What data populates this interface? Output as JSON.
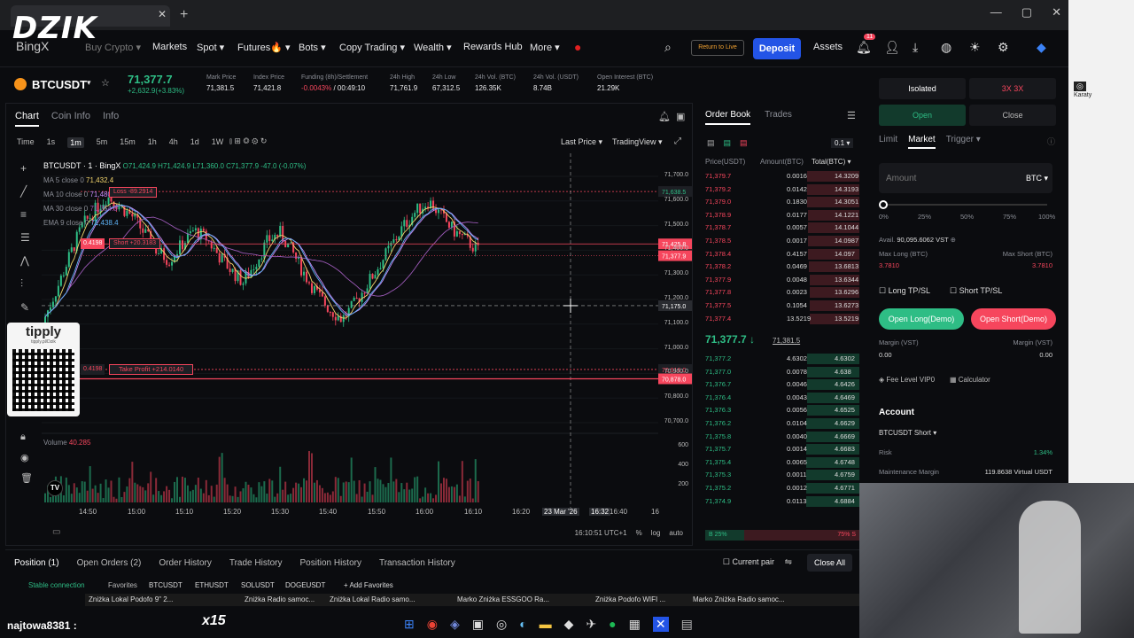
{
  "browser": {
    "new_tab": "+",
    "close_tab": "✕",
    "win": [
      "—",
      "▢",
      "✕"
    ]
  },
  "overlay": {
    "logo": "DZIK",
    "sub": "BingX"
  },
  "nav": {
    "items": [
      "Buy Crypto ▾",
      "Markets",
      "Spot ▾",
      "Futures🔥 ▾",
      "Bots ▾",
      "Copy Trading ▾",
      "Wealth ▾",
      "Rewards Hub",
      "More ▾"
    ],
    "return_live": "Return to Live",
    "deposit": "Deposit",
    "assets": "Assets",
    "notif_count": "11"
  },
  "ticker": {
    "symbol": "BTCUSDT",
    "last_price": "71,377.7",
    "change": "+2,632.9(+3.83%)",
    "stats": [
      {
        "label": "Mark Price",
        "value": "71,381.5"
      },
      {
        "label": "Index Price",
        "value": "71,421.8"
      },
      {
        "label": "Funding (8h)/Settlement",
        "value": "-0.0043%",
        "value2": "00:49:10"
      },
      {
        "label": "24h High",
        "value": "71,761.9"
      },
      {
        "label": "24h Low",
        "value": "67,312.5"
      },
      {
        "label": "24h Vol. (BTC)",
        "value": "126.35K"
      },
      {
        "label": "24h Vol. (USDT)",
        "value": "8.74B"
      },
      {
        "label": "Open Interest (BTC)",
        "value": "21.29K"
      }
    ]
  },
  "chart": {
    "tabs": [
      "Chart",
      "Coin Info",
      "Info"
    ],
    "timeframes": [
      "Time",
      "1s",
      "1m",
      "5m",
      "15m",
      "1h",
      "4h",
      "1d",
      "1W"
    ],
    "last_price_menu": "Last Price ▾",
    "tradingview_menu": "TradingView ▾",
    "legend": {
      "title": "BTCUSDT · 1 · BingX",
      "ohlc": "O71,424.9 H71,424.9 L71,360.0 C71,377.9 -47.0 (-0.07%)",
      "ma5": "MA 5 close 0",
      "ma5_val": "71,432.4",
      "ma10": "MA 10 close 0",
      "ma10_val": "71,480.8",
      "ma30": "MA 30 close 0",
      "ma30_val": "71,354.0",
      "ema9": "EMA 9 close 0",
      "ema9_val": "71,438.4",
      "volume": "Volume",
      "volume_val": "40.285"
    },
    "position_labels": {
      "stop_loss": "Loss -89.2914",
      "short": "Short +20.3183",
      "short_qty": "0.4198",
      "take_profit": "Take Profit +214.0140",
      "tp_qty": "0.4198"
    },
    "price_axis": [
      "71,700.0",
      "71,600.0",
      "71,500.0",
      "71,400.0",
      "71,300.0",
      "71,200.0",
      "71,100.0",
      "71,000.0",
      "70,900.0",
      "70,800.0",
      "70,700.0"
    ],
    "price_tags": {
      "top": "71,638.5",
      "short": "71,425.8",
      "last": "71,377.9",
      "cross": "71,175.0",
      "tp": "70,916.0",
      "red": "70,878.0"
    },
    "vol_axis": [
      "600",
      "400",
      "200"
    ],
    "time_axis": [
      "14:50",
      "15:00",
      "15:10",
      "15:20",
      "15:30",
      "15:40",
      "15:50",
      "16:00",
      "16:10",
      "16:20",
      "23 Mar '26",
      "16:32",
      "16:40",
      "16"
    ],
    "footer": {
      "clock": "16:10:51 UTC+1",
      "pct": "%",
      "log": "log",
      "auto": "auto"
    }
  },
  "tippy": {
    "brand": "tipply",
    "url": "tipply.pl/Dzik"
  },
  "orderbook": {
    "tabs": [
      "Order Book",
      "Trades"
    ],
    "step": "0.1 ▾",
    "headers": [
      "Price(USDT)",
      "Amount(BTC)",
      "Total(BTC) ▾"
    ],
    "asks": [
      [
        "71,379.7",
        "0.0016",
        "14.3209"
      ],
      [
        "71,379.2",
        "0.0142",
        "14.3193"
      ],
      [
        "71,379.0",
        "0.1830",
        "14.3051"
      ],
      [
        "71,378.9",
        "0.0177",
        "14.1221"
      ],
      [
        "71,378.7",
        "0.0057",
        "14.1044"
      ],
      [
        "71,378.5",
        "0.0017",
        "14.0987"
      ],
      [
        "71,378.4",
        "0.4157",
        "14.097"
      ],
      [
        "71,378.2",
        "0.0469",
        "13.6813"
      ],
      [
        "71,377.9",
        "0.0048",
        "13.6344"
      ],
      [
        "71,377.8",
        "0.0023",
        "13.6296"
      ],
      [
        "71,377.5",
        "0.1054",
        "13.6273"
      ],
      [
        "71,377.4",
        "13.5219",
        "13.5219"
      ]
    ],
    "mid": "71,377.7 ↓",
    "mid_mark": "71,381.5",
    "bids": [
      [
        "71,377.2",
        "4.6302",
        "4.6302"
      ],
      [
        "71,377.0",
        "0.0078",
        "4.638"
      ],
      [
        "71,376.7",
        "0.0046",
        "4.6426"
      ],
      [
        "71,376.4",
        "0.0043",
        "4.6469"
      ],
      [
        "71,376.3",
        "0.0056",
        "4.6525"
      ],
      [
        "71,376.2",
        "0.0104",
        "4.6629"
      ],
      [
        "71,375.8",
        "0.0040",
        "4.6669"
      ],
      [
        "71,375.7",
        "0.0014",
        "4.6683"
      ],
      [
        "71,375.4",
        "0.0065",
        "4.6748"
      ],
      [
        "71,375.3",
        "0.0011",
        "4.6759"
      ],
      [
        "71,375.2",
        "0.0012",
        "4.6771"
      ],
      [
        "71,374.9",
        "0.0113",
        "4.6884"
      ]
    ],
    "ratio": {
      "buy": "B  25%",
      "sell": "75%  S"
    }
  },
  "trade": {
    "margin_mode": "Isolated",
    "leverage": "3X  3X",
    "open": "Open",
    "close": "Close",
    "types": [
      "Limit",
      "Market",
      "Trigger ▾"
    ],
    "amount_placeholder": "Amount",
    "amount_unit": "BTC ▾",
    "slider_marks": [
      "0%",
      "25%",
      "50%",
      "75%",
      "100%"
    ],
    "avail_label": "Avail.",
    "avail_value": "90,095.6062 VST",
    "max_long_label": "Max Long (BTC)",
    "max_long_value": "3.7810",
    "max_short_label": "Max Short (BTC)",
    "max_short_value": "3.7810",
    "long_tpsl": "Long TP/SL",
    "short_tpsl": "Short TP/SL",
    "open_long": "Open Long(Demo)",
    "open_short": "Open Short(Demo)",
    "margin_long_label": "Margin (VST)",
    "margin_long_value": "0.00",
    "margin_short_label": "Margin (VST)",
    "margin_short_value": "0.00",
    "fee_level": "Fee Level VIP0",
    "calculator": "Calculator",
    "account": "Account",
    "account_pos": "BTCUSDT Short ▾",
    "risk_label": "Risk",
    "risk_value": "1.34%",
    "mm_label": "Maintenance Margin",
    "mm_value": "119.8638 Virtual USDT"
  },
  "positions": {
    "tabs": [
      "Position (1)",
      "Open Orders (2)",
      "Order History",
      "Trade History",
      "Position History",
      "Transaction History"
    ],
    "current_pair": "Current pair",
    "close_all": "Close All"
  },
  "favorites": {
    "connection": "Stable connection",
    "favorites_label": "Favorites",
    "pairs": [
      "BTCUSDT",
      "ETHUSDT",
      "SOLUSDT",
      "DOGEUSDT"
    ],
    "add": "+ Add Favorites"
  },
  "stream": {
    "chat_name": "najtowa8381 :",
    "multiplier": "x15",
    "tickers": [
      "Zniżka  Lokal  Podofo 9\" 2...",
      "Zniżka  Radio samoc...",
      "Zniżka  Lokal  Radio samo...",
      "Marko  Zniżka  ESSGOO Ra...",
      "Zniżka  Podofo WIFI ...",
      "Marko  Zniżka  Radio samoc..."
    ]
  },
  "rightstrip": {
    "name": "Karaty"
  }
}
